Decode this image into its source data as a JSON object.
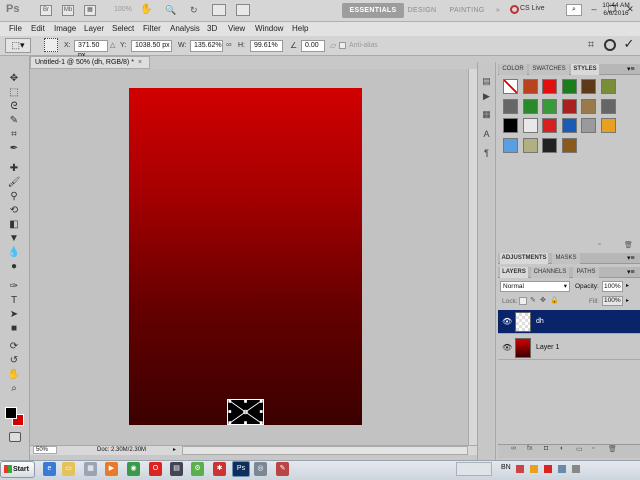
{
  "app": {
    "logo": "Ps",
    "zoom": "100%"
  },
  "workspaces": {
    "essentials": "ESSENTIALS",
    "design": "DESIGN",
    "painting": "PAINTING",
    "more": "»",
    "cs_live": "CS Live"
  },
  "menu": [
    "File",
    "Edit",
    "Image",
    "Layer",
    "Select",
    "Filter",
    "Analysis",
    "3D",
    "View",
    "Window",
    "Help"
  ],
  "options": {
    "x_label": "X:",
    "x_value": "371.50 px",
    "y_label": "Y:",
    "y_value": "1038.50 px",
    "w_label": "W:",
    "w_value": "135.62%",
    "h_label": "H:",
    "h_value": "99.61%",
    "angle_value": "0.00",
    "antialias": "Anti-alias"
  },
  "document": {
    "tab_title": "Untitled-1 @ 50% (dh, RGB/8) *",
    "close": "×"
  },
  "status": {
    "zoom": "50%",
    "doc": "Doc: 2.30M/2.30M"
  },
  "panels": {
    "top_tabs": [
      "COLOR",
      "SWATCHES",
      "STYLES"
    ],
    "mid_tabs": [
      "ADJUSTMENTS",
      "MASKS"
    ],
    "layer_tabs": [
      "LAYERS",
      "CHANNELS",
      "PATHS"
    ],
    "blend_mode": "Normal",
    "opacity_label": "Opacity:",
    "opacity_value": "100%",
    "lock_label": "Lock:",
    "fill_label": "Fill:",
    "fill_value": "100%"
  },
  "layers": [
    {
      "name": "dh",
      "selected": true
    },
    {
      "name": "Layer 1",
      "selected": false
    }
  ],
  "styles_colors": [
    "#8d5a2f",
    "#b8441f",
    "#e01010",
    "#1b7d1b",
    "#5c3a1a",
    "#7a8e3a",
    "#666666",
    "#2a8a2a",
    "#3a9a3a",
    "#a82020",
    "#9a7a4a",
    "#666666",
    "#000000",
    "#e8e8e8",
    "#d82020",
    "#1a5ab8",
    "#9a9a9a",
    "#e8a020",
    "#5aa0e0",
    "#b0b080",
    "#222222",
    "#8a5a1a"
  ],
  "taskbar": {
    "start": "Start",
    "lang": "BN",
    "time": "10:44 AM",
    "date": "6/6/2016"
  },
  "accent": "#0a246a"
}
